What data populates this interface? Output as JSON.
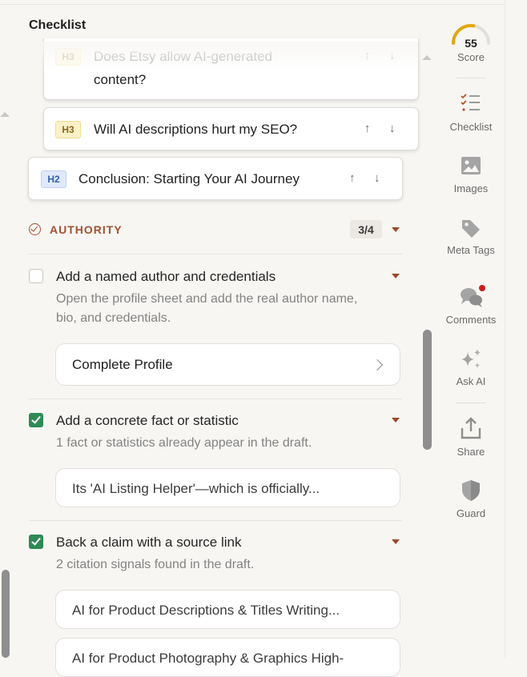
{
  "panel": {
    "title": "Checklist"
  },
  "outline": {
    "items": [
      {
        "level": "H3",
        "text": "Does Etsy allow AI-generated",
        "text2": "content?"
      },
      {
        "level": "H3",
        "text": "Will AI descriptions hurt my SEO?"
      },
      {
        "level": "H2",
        "text": "Conclusion: Starting Your AI Journey"
      }
    ],
    "up_icon": "↑",
    "down_icon": "↓"
  },
  "authority": {
    "title": "AUTHORITY",
    "count": "3/4",
    "items": [
      {
        "title": "Add a named author and credentials",
        "desc": "Open the profile sheet and add the real author name, bio, and credentials.",
        "checked": false,
        "action": "Complete Profile"
      },
      {
        "title": "Add a concrete fact or statistic",
        "desc": "1 fact or statistics already appear in the draft.",
        "checked": true,
        "evidence": [
          "Its 'AI Listing Helper'—which is officially..."
        ]
      },
      {
        "title": "Back a claim with a source link",
        "desc": "2 citation signals found in the draft.",
        "checked": true,
        "evidence": [
          "AI for Product Descriptions & Titles Writing...",
          "AI for Product Photography & Graphics High-"
        ]
      }
    ]
  },
  "rail": {
    "score": {
      "value": "55",
      "label": "Score",
      "fraction": 0.55,
      "color": "#e0a812"
    },
    "items": [
      {
        "label": "Checklist",
        "icon": "checklist-icon"
      },
      {
        "label": "Images",
        "icon": "image-icon"
      },
      {
        "label": "Meta Tags",
        "icon": "tag-icon"
      },
      {
        "label": "Comments",
        "icon": "comments-icon"
      },
      {
        "label": "Ask AI",
        "icon": "sparkle-icon"
      },
      {
        "label": "Share",
        "icon": "share-icon"
      },
      {
        "label": "Guard",
        "icon": "shield-icon"
      }
    ]
  },
  "colors": {
    "accent": "#a3522d",
    "check": "#2e8a55",
    "notify": "#c81e1e"
  }
}
